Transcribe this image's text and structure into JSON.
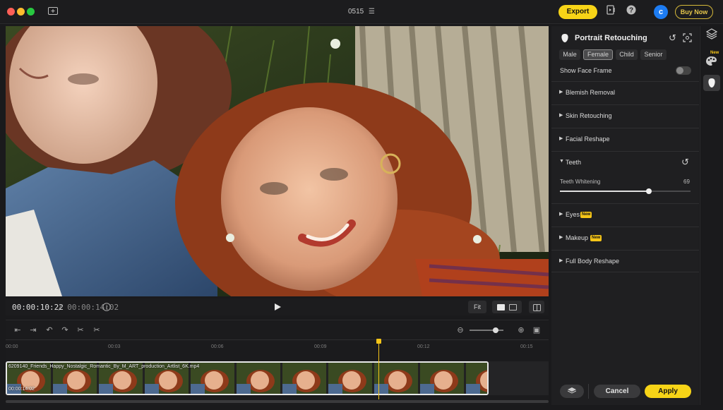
{
  "window": {
    "title": "0515"
  },
  "titlebar": {
    "export_label": "Export",
    "avatar_initial": "c",
    "buy_now_label": "Buy Now"
  },
  "player": {
    "current_time": "00:00:10:22",
    "total_time": "/ 00:00:14:02",
    "fit_label": "Fit"
  },
  "timeline": {
    "ticks": [
      "00:00",
      "00:03",
      "00:06",
      "00:09",
      "00:12",
      "00:15"
    ],
    "clip_name": "6209140_Friends_Happy_Nostalgic_Romantic_By_M_ART_production_Artlist_6K.mp4",
    "clip_duration": "00:00:14:02"
  },
  "panel": {
    "title": "Portrait Retouching",
    "gender_tabs": [
      "Male",
      "Female",
      "Child",
      "Senior"
    ],
    "active_tab": "Female",
    "show_face_frame_label": "Show Face Frame",
    "show_face_frame_on": false,
    "sections": {
      "blemish": "Blemish Removal",
      "skin": "Skin Retouching",
      "reshape": "Facial Reshape",
      "teeth": "Teeth",
      "eyes": "Eyes",
      "makeup": "Makeup",
      "body": "Full Body Reshape"
    },
    "new_badge": "New",
    "teeth_whitening_label": "Teeth Whitening",
    "teeth_whitening_value": "69",
    "cancel_label": "Cancel",
    "apply_label": "Apply"
  },
  "sidebar": {
    "new_badge": "New"
  },
  "colors": {
    "accent": "#f7d417",
    "avatar": "#1d7cf2"
  }
}
